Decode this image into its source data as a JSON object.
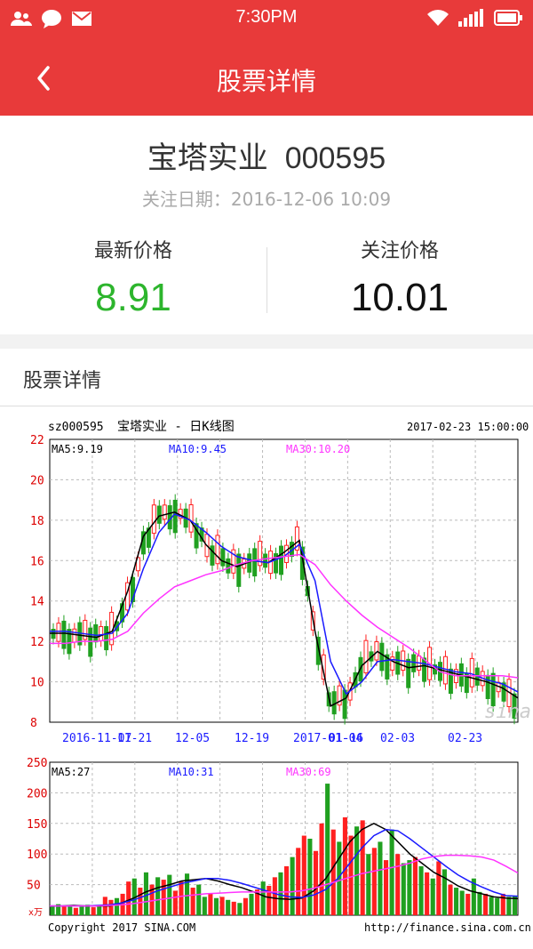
{
  "status_bar": {
    "time": "7:30PM"
  },
  "app_bar": {
    "title": "股票详情"
  },
  "stock": {
    "name_code": "宝塔实业  000595",
    "follow_date": "关注日期：2016-12-06 10:09",
    "latest_price_label": "最新价格",
    "latest_price": "8.91",
    "follow_price_label": "关注价格",
    "follow_price": "10.01"
  },
  "section": {
    "title": "股票详情"
  },
  "colors": {
    "accent": "#e83a3a",
    "down": "#2db52d",
    "ma5": "#000000",
    "ma10": "#1a1aff",
    "ma30": "#ff33ff"
  },
  "chart_data": [
    {
      "type": "line",
      "code": "sz000595",
      "title": "宝塔实业 - 日K线图",
      "timestamp": "2017-02-23 15:00:00",
      "watermark": "sina",
      "ylim": [
        8,
        22
      ],
      "yticks": [
        "22",
        "20",
        "18",
        "16",
        "14",
        "12",
        "10",
        "8"
      ],
      "xticks": [
        "2016-11-07",
        "11-21",
        "12-05",
        "12-19",
        "2017-01-04",
        "01-16",
        "02-03",
        "02-23"
      ],
      "legend": [
        {
          "name": "MA5:9.19",
          "color": "#000000"
        },
        {
          "name": "MA10:9.45",
          "color": "#1a1aff"
        },
        {
          "name": "MA30:10.20",
          "color": "#ff33ff"
        }
      ],
      "x": [
        0,
        3,
        6,
        9,
        12,
        15,
        18,
        21,
        24,
        27,
        30,
        33,
        36,
        39,
        42,
        45,
        48,
        51,
        54,
        57,
        60,
        63,
        66,
        69,
        72,
        75,
        78,
        81,
        84,
        87,
        90
      ],
      "series": [
        {
          "name": "MA5:9.19",
          "color": "#000000",
          "values": [
            12.4,
            12.4,
            12.3,
            12.2,
            12.5,
            14.5,
            17.2,
            18.2,
            18.4,
            18.0,
            16.8,
            16.0,
            15.7,
            16.0,
            15.9,
            16.4,
            17.0,
            12.5,
            8.8,
            9.2,
            10.8,
            11.5,
            11.0,
            10.7,
            10.8,
            10.6,
            10.4,
            10.2,
            10.0,
            9.7,
            9.2
          ]
        },
        {
          "name": "MA10:9.45",
          "color": "#1a1aff",
          "values": [
            12.5,
            12.5,
            12.4,
            12.3,
            12.4,
            13.4,
            15.6,
            17.4,
            18.3,
            18.0,
            17.4,
            16.7,
            16.2,
            16.0,
            15.9,
            16.2,
            16.8,
            15.0,
            11.0,
            9.4,
            10.0,
            11.0,
            11.1,
            11.0,
            10.9,
            10.7,
            10.5,
            10.4,
            10.1,
            9.9,
            9.5
          ]
        },
        {
          "name": "MA30:10.20",
          "color": "#ff33ff",
          "values": [
            11.9,
            11.9,
            12.0,
            12.0,
            12.1,
            12.5,
            13.4,
            14.1,
            14.7,
            15.0,
            15.3,
            15.5,
            15.8,
            16.0,
            16.1,
            16.2,
            16.3,
            15.8,
            14.8,
            14.0,
            13.3,
            12.7,
            12.2,
            11.7,
            11.1,
            10.5,
            10.3,
            10.3,
            10.3,
            10.3,
            10.2
          ]
        }
      ]
    },
    {
      "type": "bar",
      "ylim": [
        0,
        250
      ],
      "yticks": [
        "250",
        "200",
        "150",
        "100",
        "50"
      ],
      "unit": "x万",
      "legend": [
        {
          "name": "MA5:27",
          "color": "#000000"
        },
        {
          "name": "MA10:31",
          "color": "#1a1aff"
        },
        {
          "name": "MA30:69",
          "color": "#ff33ff"
        }
      ],
      "footer_left": "Copyright 2017 SINA.COM",
      "footer_right": "http://finance.sina.com.cn",
      "values": [
        15,
        18,
        14,
        16,
        12,
        14,
        17,
        13,
        15,
        30,
        25,
        28,
        35,
        55,
        60,
        45,
        70,
        50,
        62,
        58,
        66,
        40,
        55,
        68,
        45,
        50,
        30,
        35,
        28,
        30,
        25,
        22,
        20,
        28,
        35,
        42,
        55,
        48,
        62,
        70,
        80,
        95,
        110,
        130,
        125,
        105,
        150,
        215,
        140,
        120,
        160,
        130,
        145,
        155,
        100,
        110,
        120,
        90,
        140,
        100,
        85,
        90,
        95,
        80,
        70,
        60,
        88,
        75,
        50,
        45,
        40,
        35,
        60,
        38,
        35,
        30,
        28,
        35,
        30,
        32
      ],
      "bar_colors": [
        "g",
        "g",
        "r",
        "g",
        "r",
        "g",
        "g",
        "r",
        "g",
        "r",
        "r",
        "g",
        "r",
        "r",
        "g",
        "r",
        "g",
        "r",
        "g",
        "r",
        "g",
        "r",
        "r",
        "g",
        "r",
        "g",
        "g",
        "r",
        "g",
        "r",
        "g",
        "r",
        "g",
        "r",
        "g",
        "r",
        "g",
        "r",
        "r",
        "g",
        "r",
        "g",
        "r",
        "r",
        "g",
        "r",
        "r",
        "g",
        "r",
        "g",
        "r",
        "r",
        "g",
        "r",
        "g",
        "r",
        "g",
        "r",
        "g",
        "r",
        "g",
        "g",
        "r",
        "g",
        "r",
        "g",
        "r",
        "g",
        "r",
        "g",
        "g",
        "r",
        "g",
        "g",
        "r",
        "g",
        "g",
        "r",
        "g",
        "g"
      ],
      "series": [
        {
          "name": "MA5:27",
          "color": "#000000",
          "values": [
            15,
            15,
            16,
            15,
            15,
            15,
            20,
            28,
            38,
            45,
            50,
            56,
            58,
            60,
            56,
            50,
            45,
            38,
            30,
            27,
            26,
            28,
            40,
            60,
            90,
            120,
            140,
            150,
            140,
            120,
            100,
            85,
            70,
            60,
            48,
            40,
            35,
            30,
            28,
            27
          ]
        },
        {
          "name": "MA10:31",
          "color": "#1a1aff",
          "values": [
            15,
            15,
            15,
            15,
            16,
            17,
            20,
            25,
            32,
            40,
            46,
            52,
            56,
            60,
            60,
            57,
            52,
            46,
            40,
            34,
            30,
            29,
            33,
            42,
            60,
            85,
            110,
            130,
            140,
            138,
            125,
            110,
            95,
            80,
            66,
            55,
            46,
            38,
            32,
            31
          ]
        },
        {
          "name": "MA30:69",
          "color": "#ff33ff",
          "values": [
            15,
            15,
            15,
            15,
            15,
            16,
            17,
            19,
            22,
            25,
            28,
            31,
            33,
            35,
            36,
            37,
            38,
            38,
            38,
            38,
            38,
            40,
            44,
            50,
            56,
            62,
            68,
            72,
            76,
            80,
            85,
            92,
            96,
            98,
            98,
            97,
            95,
            90,
            80,
            69
          ]
        }
      ]
    }
  ]
}
